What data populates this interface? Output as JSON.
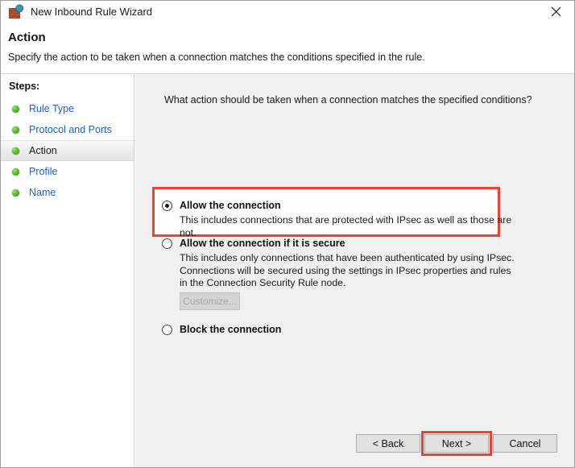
{
  "window": {
    "title": "New Inbound Rule Wizard",
    "icon": "firewall-rule-icon",
    "close_label": "close-icon"
  },
  "header": {
    "title": "Action",
    "subtitle": "Specify the action to be taken when a connection matches the conditions specified in the rule."
  },
  "sidebar": {
    "heading": "Steps:",
    "items": [
      {
        "label": "Rule Type",
        "current": false
      },
      {
        "label": "Protocol and Ports",
        "current": false
      },
      {
        "label": "Action",
        "current": true
      },
      {
        "label": "Profile",
        "current": false
      },
      {
        "label": "Name",
        "current": false
      }
    ]
  },
  "main": {
    "question": "What action should be taken when a connection matches the specified conditions?",
    "options": [
      {
        "title": "Allow the connection",
        "description": "This includes connections that are protected with IPsec as well as those are not.",
        "selected": true,
        "highlighted": true
      },
      {
        "title": "Allow the connection if it is secure",
        "description": "This includes only connections that have been authenticated by using IPsec.  Connections will be secured using the settings in IPsec properties and rules in the Connection Security Rule node.",
        "selected": false,
        "highlighted": false
      },
      {
        "title": "Block the connection",
        "description": "",
        "selected": false,
        "highlighted": false
      }
    ],
    "customize_button": {
      "label": "Customize...",
      "enabled": false
    }
  },
  "footer": {
    "back_label": "< Back",
    "next_label": "Next >",
    "cancel_label": "Cancel",
    "next_highlighted": true
  },
  "colors": {
    "highlight_red": "#ea4335",
    "link_blue": "#1f5fbf",
    "content_bg": "#f0f0f0",
    "sidebar_bg": "#ffffff"
  }
}
